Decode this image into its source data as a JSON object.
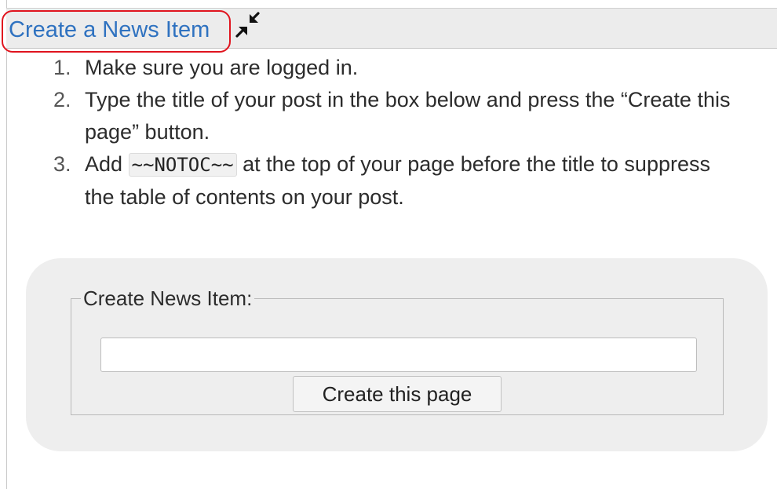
{
  "header": {
    "title_link": "Create a News Item",
    "collapse_icon": "collapse-arrows-icon",
    "highlight_color": "#e0141e",
    "link_color": "#2f72c0"
  },
  "instructions": {
    "steps": [
      {
        "number": "1.",
        "text": "Make sure you are logged in."
      },
      {
        "number": "2.",
        "text": "Type the title of your post in the box below and press the “Create this page” button."
      },
      {
        "number": "3.",
        "text_before": "Add ",
        "code": "~~NOTOC~~",
        "text_after": " at the top of your page before the title to suppress the table of contents on your post."
      }
    ]
  },
  "form": {
    "legend": "Create News Item:",
    "input_value": "",
    "input_placeholder": "",
    "button_label": "Create this page"
  }
}
